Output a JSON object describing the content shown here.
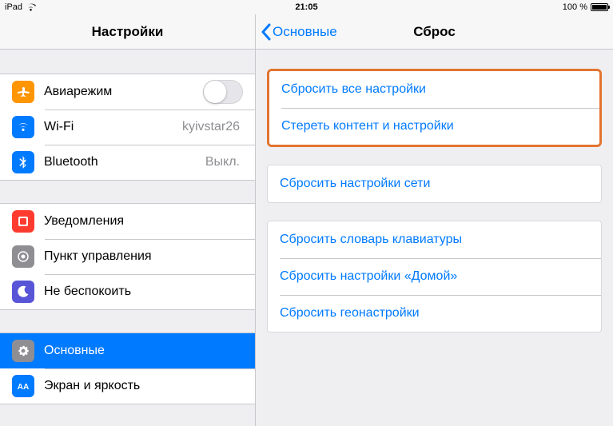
{
  "statusbar": {
    "device": "iPad",
    "time": "21:05",
    "battery_text": "100 %"
  },
  "master": {
    "title": "Настройки",
    "airplane": {
      "label": "Авиарежим"
    },
    "wifi": {
      "label": "Wi-Fi",
      "value": "kyivstar26"
    },
    "bluetooth": {
      "label": "Bluetooth",
      "value": "Выкл."
    },
    "notifications": {
      "label": "Уведомления"
    },
    "control_center": {
      "label": "Пункт управления"
    },
    "dnd": {
      "label": "Не беспокоить"
    },
    "general": {
      "label": "Основные"
    },
    "display": {
      "label": "Экран и яркость"
    }
  },
  "detail": {
    "back_label": "Основные",
    "title": "Сброс",
    "group1": {
      "reset_all": "Сбросить все настройки",
      "erase_all": "Стереть контент и настройки"
    },
    "group2": {
      "reset_network": "Сбросить настройки сети"
    },
    "group3": {
      "reset_keyboard": "Сбросить словарь клавиатуры",
      "reset_home": "Сбросить настройки «Домой»",
      "reset_location": "Сбросить геонастройки"
    }
  }
}
